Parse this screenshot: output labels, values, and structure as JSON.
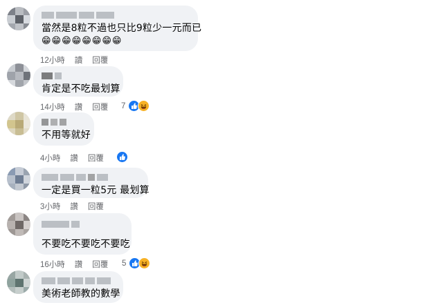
{
  "comments": [
    {
      "text": "當然是8粒不過也只比9粒少一元而已",
      "emojis": "😁😁😁😁😁😁😁😁",
      "time": "12小時",
      "reply_label": "讀",
      "reply2_label": "回覆",
      "reaction_count": ""
    },
    {
      "text": "肯定是不吃最划算",
      "time": "14小時",
      "reply_label": "讚",
      "reply2_label": "回覆",
      "reaction_count": "7"
    },
    {
      "text": "不用等就好",
      "time": "4小時",
      "reply_label": "讚",
      "reply2_label": "回覆",
      "reaction_count": ""
    },
    {
      "text": "一定是買一粒5元 最划算",
      "time": "3小時",
      "reply_label": "讚",
      "reply2_label": "回覆",
      "reaction_count": ""
    },
    {
      "text": "不要吃不要吃不要吃",
      "time": "16小時",
      "reply_label": "讚",
      "reply2_label": "回覆",
      "reaction_count": "5"
    },
    {
      "text": "美術老師教的數學",
      "time": "",
      "reply_label": "",
      "reply2_label": "",
      "reaction_count": ""
    }
  ],
  "colors": {
    "bubble": "#f0f2f5",
    "meta_text": "#65676b",
    "like_blue": "#1877f2",
    "haha_yellow": "#f7b125"
  },
  "icons": {
    "like": "thumbs-up-icon",
    "haha": "laughing-face-icon"
  }
}
